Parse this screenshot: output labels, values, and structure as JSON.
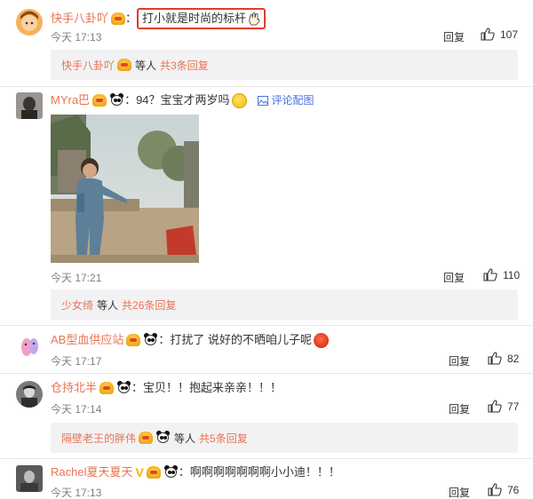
{
  "comments": [
    {
      "username": "快手八卦吖",
      "separator": "：",
      "text": "打小就是时尚的标杆",
      "time": "今天 17:13",
      "reply": "回复",
      "likes": "107",
      "sub": {
        "name": "快手八卦吖",
        "mid": "等人",
        "count": "共3条回复"
      }
    },
    {
      "username": "MYra巴",
      "separator": "：",
      "text": "94？宝宝才两岁吗",
      "img_link": "评论配图",
      "time": "今天 17:21",
      "reply": "回复",
      "likes": "110",
      "sub": {
        "name": "少女绮",
        "mid": "等人",
        "count": "共26条回复"
      }
    },
    {
      "username": "AB型血供应站",
      "separator": "：",
      "text": "打扰了 说好的不晒咱儿子呢",
      "time": "今天 17:17",
      "reply": "回复",
      "likes": "82"
    },
    {
      "username": "仓持北半",
      "separator": "：",
      "text": "宝贝！！抱起来亲亲！！！",
      "time": "今天 17:14",
      "reply": "回复",
      "likes": "77",
      "sub": {
        "name": "隔壁老王的胖伟",
        "mid": "等人",
        "count": "共5条回复"
      }
    },
    {
      "username": "Rachel夏天夏天",
      "vip": "V",
      "separator": "：",
      "text": "啊啊啊啊啊啊啊小小迪！！！",
      "time": "今天 17:13",
      "reply": "回复",
      "likes": "76"
    }
  ],
  "colors": {
    "username": "#eb7350",
    "highlight": "#e23b2a",
    "sub_bg": "#f2f2f5",
    "link": "#4a6ee0"
  }
}
